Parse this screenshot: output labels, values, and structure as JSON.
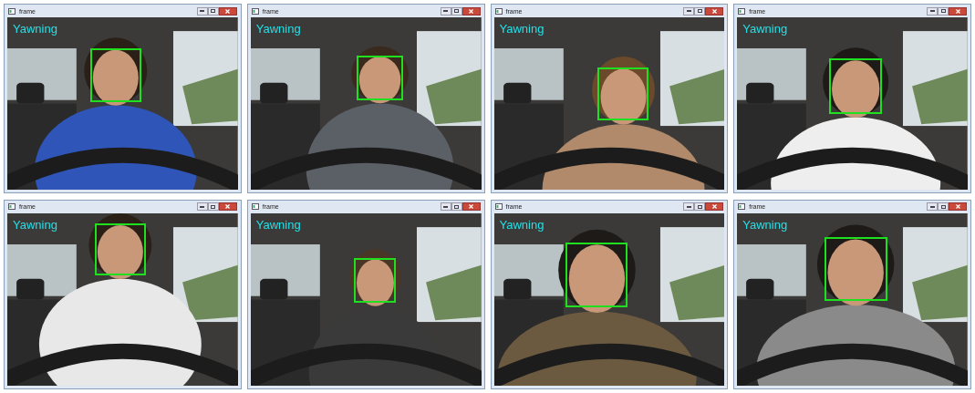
{
  "windows": [
    {
      "title": "frame",
      "label": "Yawning"
    },
    {
      "title": "frame",
      "label": "Yawning"
    },
    {
      "title": "frame",
      "label": "Yawning"
    },
    {
      "title": "frame",
      "label": "Yawning"
    },
    {
      "title": "frame",
      "label": "Yawning"
    },
    {
      "title": "frame",
      "label": "Yawning"
    },
    {
      "title": "frame",
      "label": "Yawning"
    },
    {
      "title": "frame",
      "label": "Yawning"
    }
  ]
}
